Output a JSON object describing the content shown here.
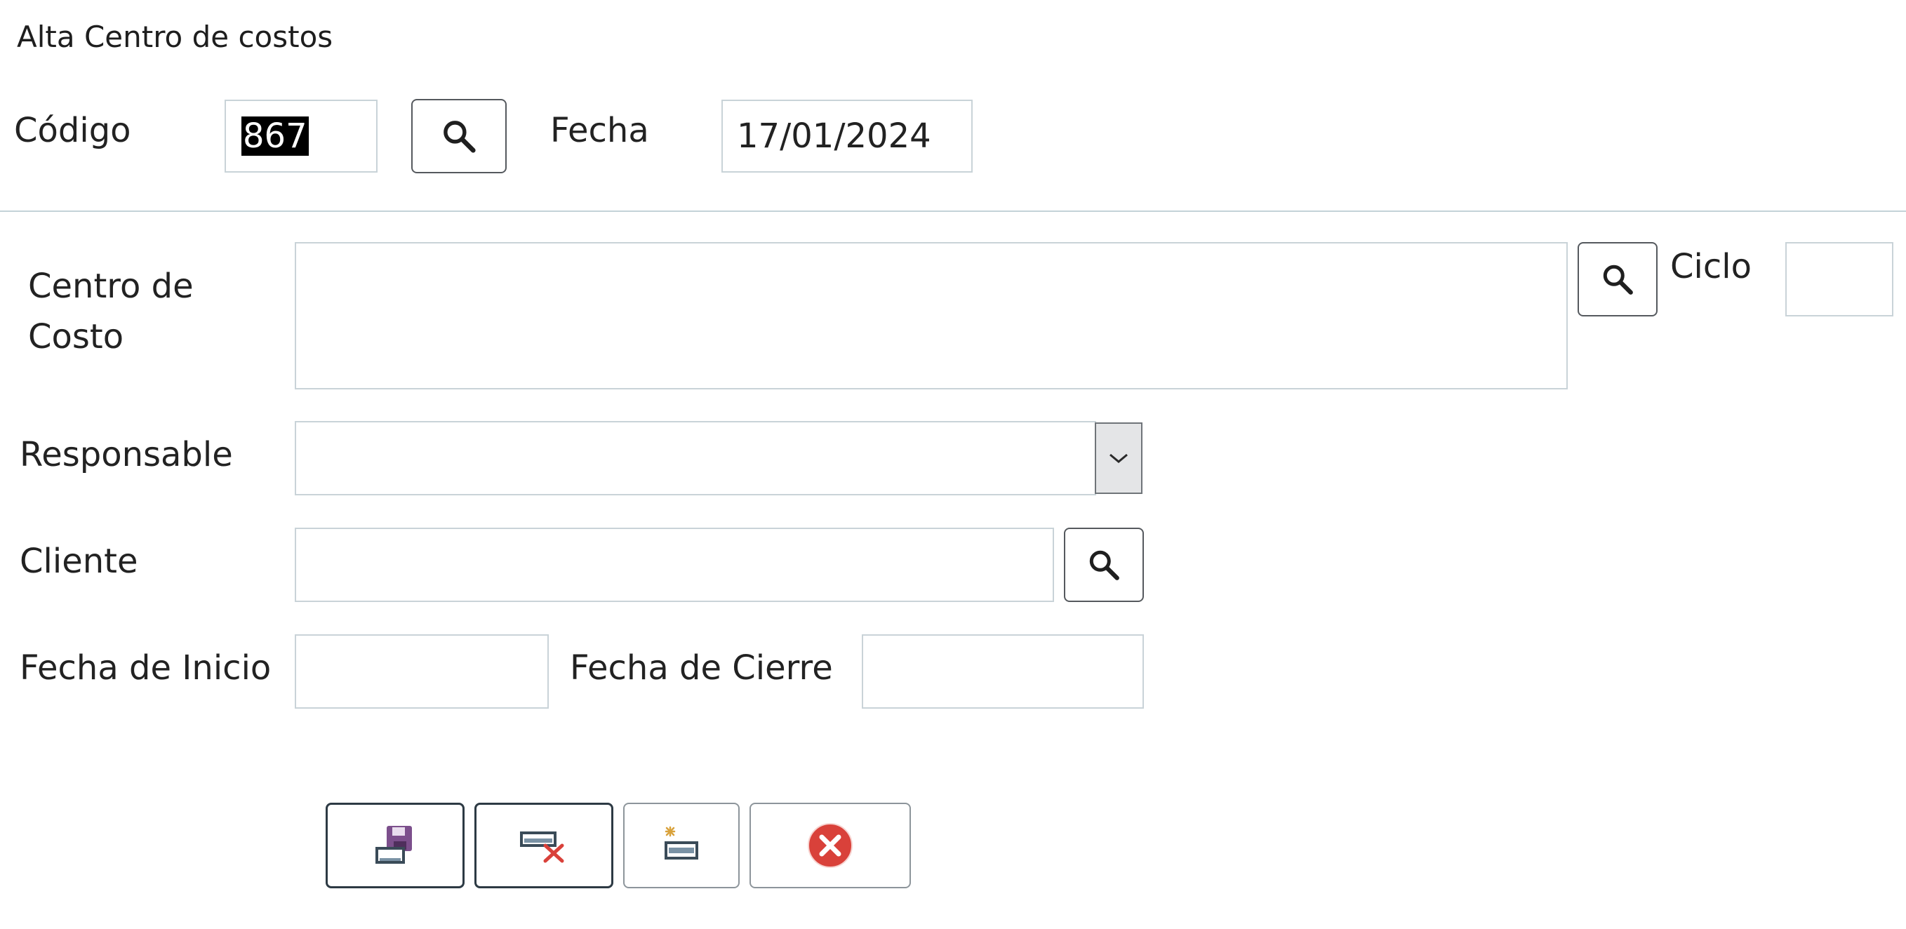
{
  "form": {
    "title": "Alta Centro de costos",
    "codigo_label": "Código",
    "codigo_value": "867",
    "fecha_label": "Fecha",
    "fecha_value": "17/01/2024",
    "centro_label_line1": "Centro de",
    "centro_label_line2": "Costo",
    "centro_value": "",
    "ciclo_label": "Ciclo",
    "ciclo_value": "",
    "responsable_label": "Responsable",
    "responsable_value": "",
    "cliente_label": "Cliente",
    "cliente_value": "",
    "fecha_inicio_label": "Fecha de Inicio",
    "fecha_inicio_value": "",
    "fecha_cierre_label": "Fecha de Cierre",
    "fecha_cierre_value": ""
  },
  "icons": {
    "search": "magnifier-icon",
    "dropdown": "chevron-down-icon",
    "save": "save-icon",
    "delete": "delete-record-icon",
    "new": "new-record-icon",
    "close": "close-circle-icon"
  },
  "colors": {
    "field_border": "#c9d3d8",
    "button_border": "#2d3a44",
    "close_red": "#d9413a",
    "save_purple": "#7c4f8c"
  }
}
